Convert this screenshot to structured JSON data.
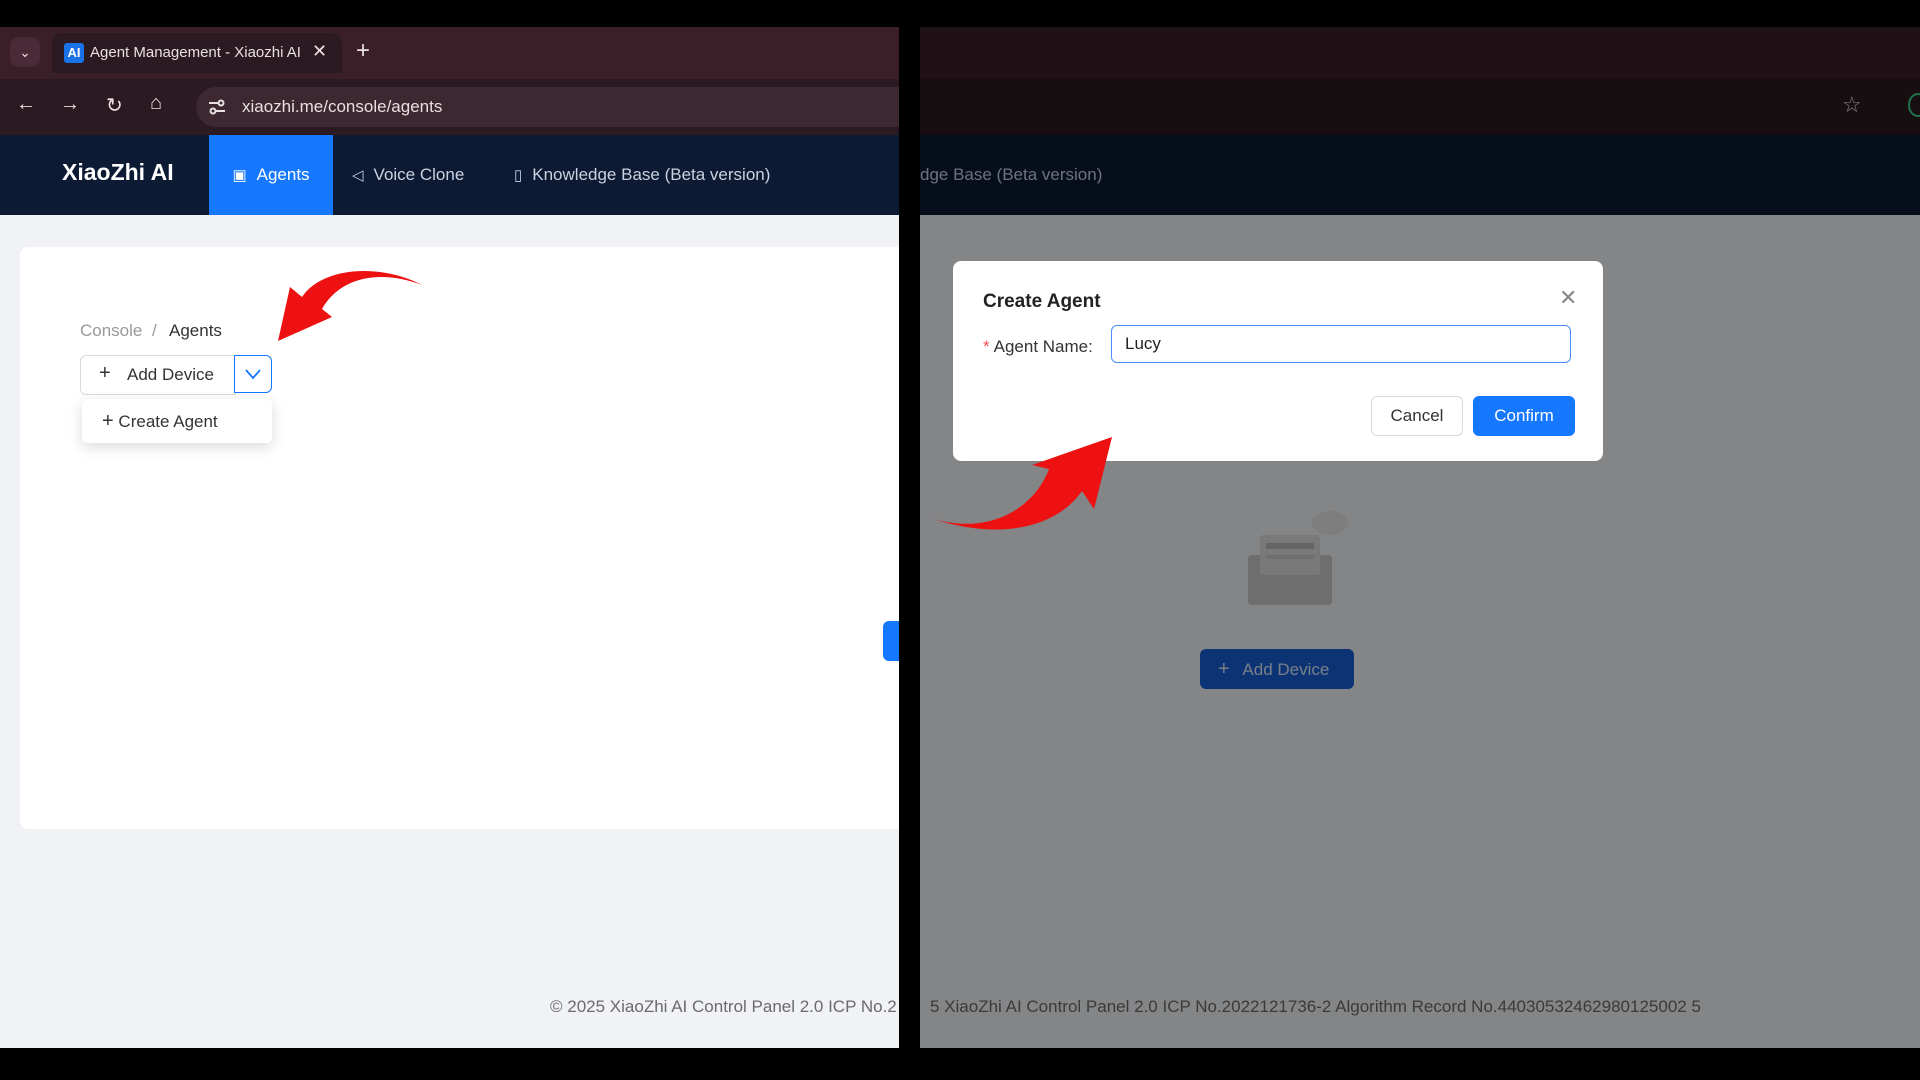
{
  "browser": {
    "tab_title": "Agent Management - Xiaozhi AI",
    "tab_favicon": "AI",
    "url": "xiaozhi.me/console/agents"
  },
  "nav": {
    "brand": "XiaoZhi AI",
    "items": [
      {
        "label": "Agents",
        "icon": "agents-icon",
        "active": true
      },
      {
        "label": "Voice Clone",
        "icon": "speaker-icon",
        "active": false
      },
      {
        "label": "Knowledge Base (Beta version)",
        "icon": "book-icon",
        "active": false
      }
    ],
    "right_partial": "dge Base (Beta version)"
  },
  "breadcrumb": {
    "root": "Console",
    "separator": "/",
    "current": "Agents"
  },
  "toolbar": {
    "add_device_label": "Add Device"
  },
  "dropdown": {
    "create_agent_label": "Create Agent"
  },
  "footer": {
    "left_text": "© 2025 XiaoZhi AI Control Panel 2.0 ICP No.2",
    "right_text": "5 XiaoZhi AI Control Panel 2.0 ICP No.2022121736-2 Algorithm Record No.44030532462980125002 5"
  },
  "modal": {
    "title": "Create Agent",
    "field_label": "Agent Name:",
    "field_value": "Lucy",
    "cancel_label": "Cancel",
    "confirm_label": "Confirm"
  },
  "empty_state": {
    "add_device_label": "Add Device"
  },
  "colors": {
    "primary": "#1677ff",
    "nav_bg": "#0c1a33",
    "arrow": "#ee1111"
  }
}
